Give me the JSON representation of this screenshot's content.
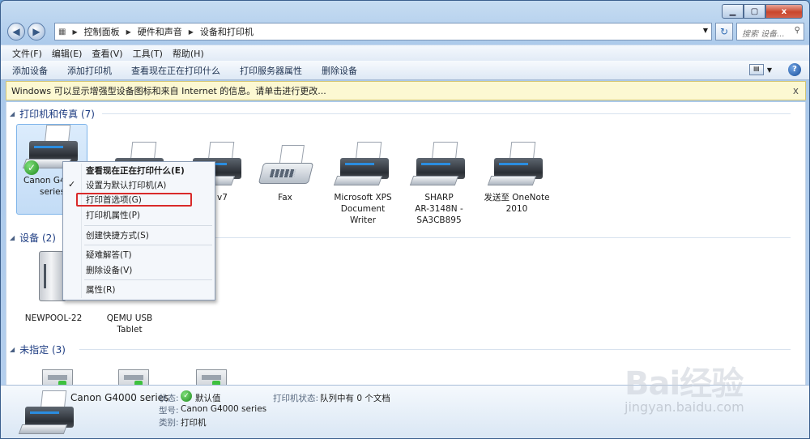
{
  "window": {
    "minimize": "▁",
    "maximize": "▢",
    "close": "x"
  },
  "nav": {
    "back": "◀",
    "forward": "▶",
    "breadcrumbs": [
      "控制面板",
      "硬件和声音",
      "设备和打印机"
    ],
    "search_placeholder": "搜索 设备...",
    "refresh": "↻"
  },
  "menubar": [
    "文件(F)",
    "编辑(E)",
    "查看(V)",
    "工具(T)",
    "帮助(H)"
  ],
  "toolbar": [
    "添加设备",
    "添加打印机",
    "查看现在正在打印什么",
    "打印服务器属性",
    "删除设备"
  ],
  "infobar": {
    "text": "Windows 可以显示增强型设备图标和来自 Internet 的信息。请单击进行更改...",
    "close": "x"
  },
  "groups": {
    "printers": "打印机和传真 (7)",
    "devices": "设备 (2)",
    "unspecified": "未指定 (3)"
  },
  "printers": [
    {
      "label": "Canon G4000 series",
      "line1": "Canon G4",
      "line2": "series",
      "default": true
    },
    {
      "label": "v7",
      "line1": "v7",
      "line2": ""
    },
    {
      "label": "Fax",
      "line1": "Fax",
      "line2": ""
    },
    {
      "label": "Microsoft XPS Document Writer",
      "line1": "Microsoft XPS",
      "line2": "Document",
      "line3": "Writer"
    },
    {
      "label": "SHARP AR-3148N - SA3CB895",
      "line1": "SHARP",
      "line2": "AR-3148N -",
      "line3": "SA3CB895"
    },
    {
      "label": "发送至 OneNote 2010",
      "line1": "发送至 OneNote",
      "line2": "2010"
    }
  ],
  "devices": [
    {
      "line1": "NEWPOOL-22",
      "line2": ""
    },
    {
      "line1": "QEMU USB",
      "line2": "Tablet"
    }
  ],
  "context_menu": {
    "items": [
      "查看现在正在打印什么(E)",
      "设置为默认打印机(A)",
      "打印首选项(G)",
      "打印机属性(P)",
      "创建快捷方式(S)",
      "疑难解答(T)",
      "删除设备(V)",
      "属性(R)"
    ],
    "checked": "✓"
  },
  "details": {
    "name": "Canon G4000 series",
    "status_label": "状态:",
    "status_value": "默认值",
    "model_label": "型号:",
    "model_value": "Canon G4000 series",
    "category_label": "类别:",
    "category_value": "打印机",
    "printer_status_label": "打印机状态:",
    "printer_status_value": "队列中有 0 个文档"
  },
  "watermark": {
    "text": "Bai经验",
    "url": "jingyan.baidu.com"
  }
}
